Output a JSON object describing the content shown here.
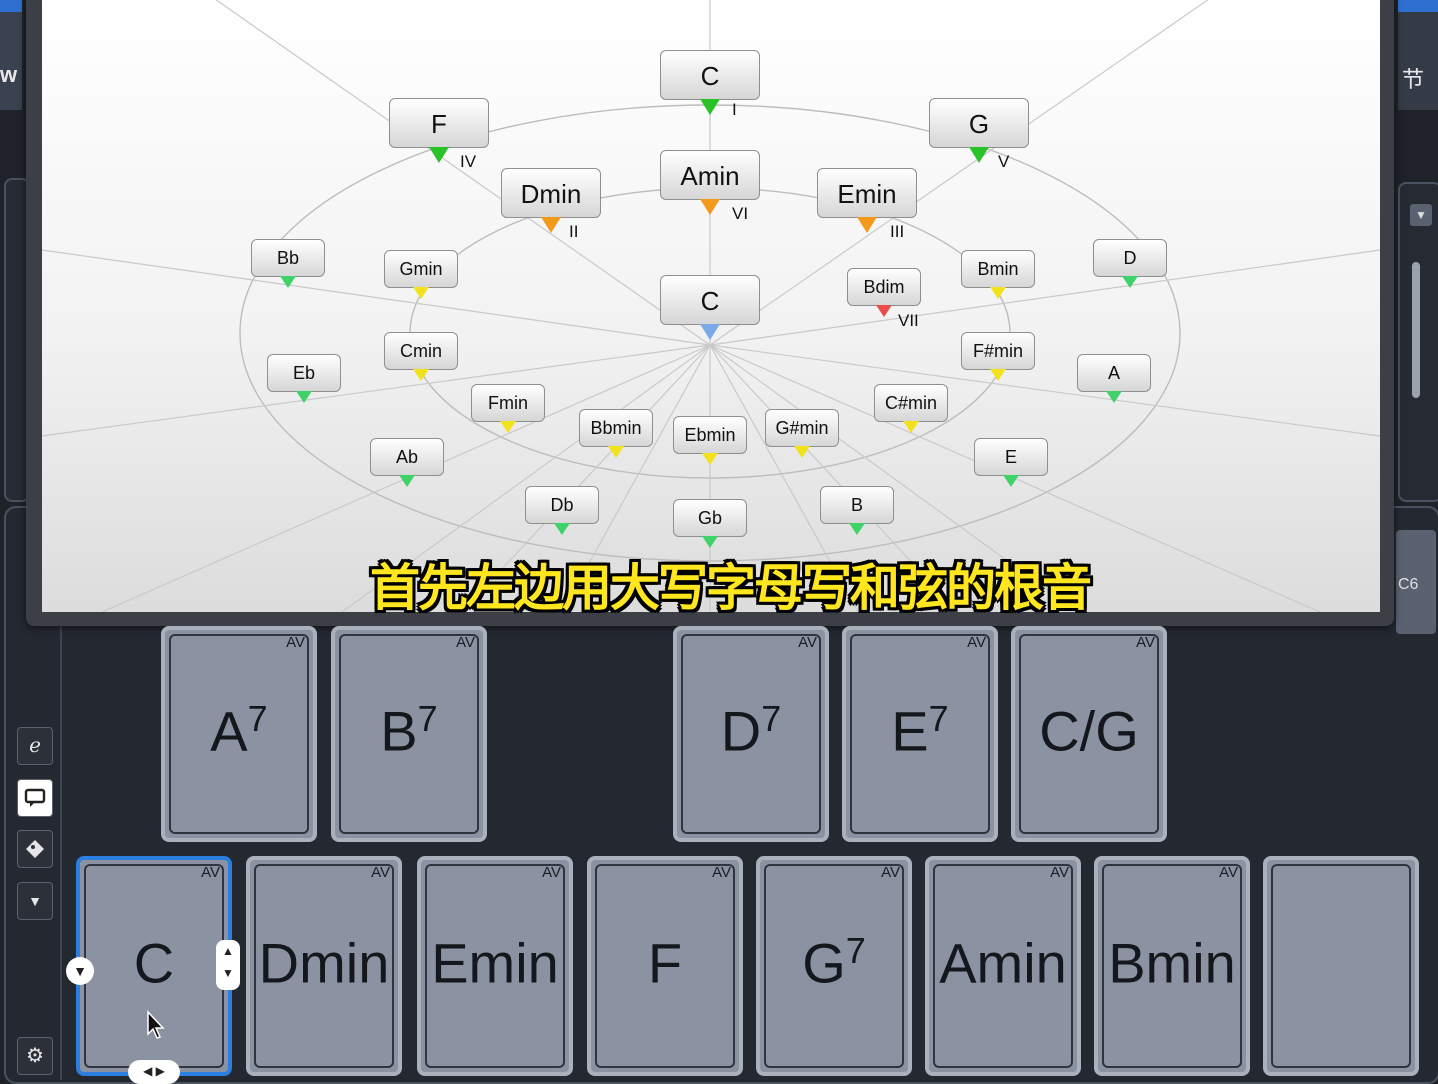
{
  "edges": {
    "left_text": "w",
    "right_text": "节"
  },
  "right_stub_label": "C6",
  "circle": {
    "key_center": {
      "label": "C"
    },
    "diatonic": [
      {
        "label": "C",
        "roman": "I",
        "color": "#29c229"
      },
      {
        "label": "F",
        "roman": "IV",
        "color": "#29c229"
      },
      {
        "label": "G",
        "roman": "V",
        "color": "#29c229"
      },
      {
        "label": "Amin",
        "roman": "VI",
        "color": "#f39a1c"
      },
      {
        "label": "Dmin",
        "roman": "II",
        "color": "#f39a1c"
      },
      {
        "label": "Emin",
        "roman": "III",
        "color": "#f39a1c"
      },
      {
        "label": "Bdim",
        "roman": "VII",
        "color": "#ea4b4b"
      }
    ],
    "major_ring": [
      {
        "label": "Bb",
        "color": "#3fd26a"
      },
      {
        "label": "Eb",
        "color": "#3fd26a"
      },
      {
        "label": "Ab",
        "color": "#3fd26a"
      },
      {
        "label": "Db",
        "color": "#3fd26a"
      },
      {
        "label": "Gb",
        "color": "#3fd26a"
      },
      {
        "label": "B",
        "color": "#3fd26a"
      },
      {
        "label": "E",
        "color": "#3fd26a"
      },
      {
        "label": "A",
        "color": "#3fd26a"
      },
      {
        "label": "D",
        "color": "#3fd26a"
      }
    ],
    "minor_ring": [
      {
        "label": "Gmin",
        "color": "#f2e21c"
      },
      {
        "label": "Cmin",
        "color": "#f2e21c"
      },
      {
        "label": "Fmin",
        "color": "#f2e21c"
      },
      {
        "label": "Bbmin",
        "color": "#f2e21c"
      },
      {
        "label": "Ebmin",
        "color": "#f2e21c"
      },
      {
        "label": "G#min",
        "color": "#f2e21c"
      },
      {
        "label": "C#min",
        "color": "#f2e21c"
      },
      {
        "label": "F#min",
        "color": "#f2e21c"
      },
      {
        "label": "Bmin",
        "color": "#f2e21c"
      }
    ],
    "center_color": "#7aa9e8"
  },
  "subtitle": "首先左边用大写字母写和弦的根音",
  "pads_top": [
    {
      "tag": "AV",
      "root": "A",
      "ext": "7"
    },
    {
      "tag": "AV",
      "root": "B",
      "ext": "7"
    },
    {
      "tag": "AV",
      "root": "D",
      "ext": "7"
    },
    {
      "tag": "AV",
      "root": "E",
      "ext": "7"
    },
    {
      "tag": "AV",
      "root": "C/G",
      "ext": ""
    }
  ],
  "pads_bottom": [
    {
      "tag": "AV",
      "root": "C",
      "ext": ""
    },
    {
      "tag": "AV",
      "root": "Dmin",
      "ext": ""
    },
    {
      "tag": "AV",
      "root": "Emin",
      "ext": ""
    },
    {
      "tag": "AV",
      "root": "F",
      "ext": ""
    },
    {
      "tag": "AV",
      "root": "G",
      "ext": "7"
    },
    {
      "tag": "AV",
      "root": "Amin",
      "ext": ""
    },
    {
      "tag": "AV",
      "root": "Bmin",
      "ext": ""
    },
    {
      "tag": "",
      "root": "",
      "ext": ""
    }
  ],
  "toolbar_icons": [
    "editor-icon",
    "comment-icon",
    "tag-icon",
    "dropdown-icon",
    "settings-icon"
  ]
}
